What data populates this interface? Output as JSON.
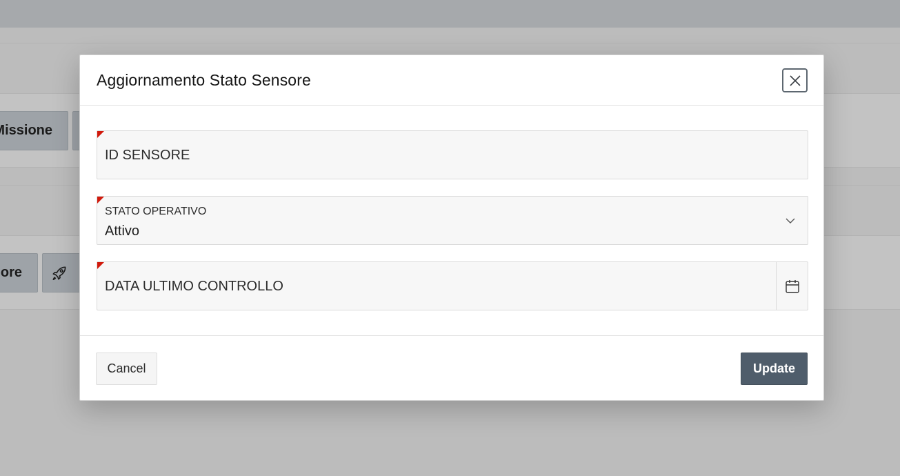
{
  "background": {
    "buttons": [
      {
        "label": "Missione"
      },
      {
        "label": ""
      },
      {
        "label": "ore"
      },
      {
        "icon": "rocket-icon"
      }
    ]
  },
  "modal": {
    "title": "Aggiornamento Stato Sensore",
    "close_icon": "close-icon",
    "fields": {
      "sensor_id": {
        "label": "ID SENSORE",
        "value": "",
        "required": true
      },
      "operational_status": {
        "label": "STATO OPERATIVO",
        "value": "Attivo",
        "required": true,
        "icon": "chevron-down-icon"
      },
      "last_check_date": {
        "label": "DATA ULTIMO CONTROLLO",
        "value": "",
        "required": true,
        "icon": "calendar-icon"
      }
    },
    "footer": {
      "cancel_label": "Cancel",
      "update_label": "Update"
    }
  },
  "colors": {
    "required_marker": "#d11a0c",
    "primary_button": "#4f5d6b",
    "overlay": "#bcbcbc"
  }
}
